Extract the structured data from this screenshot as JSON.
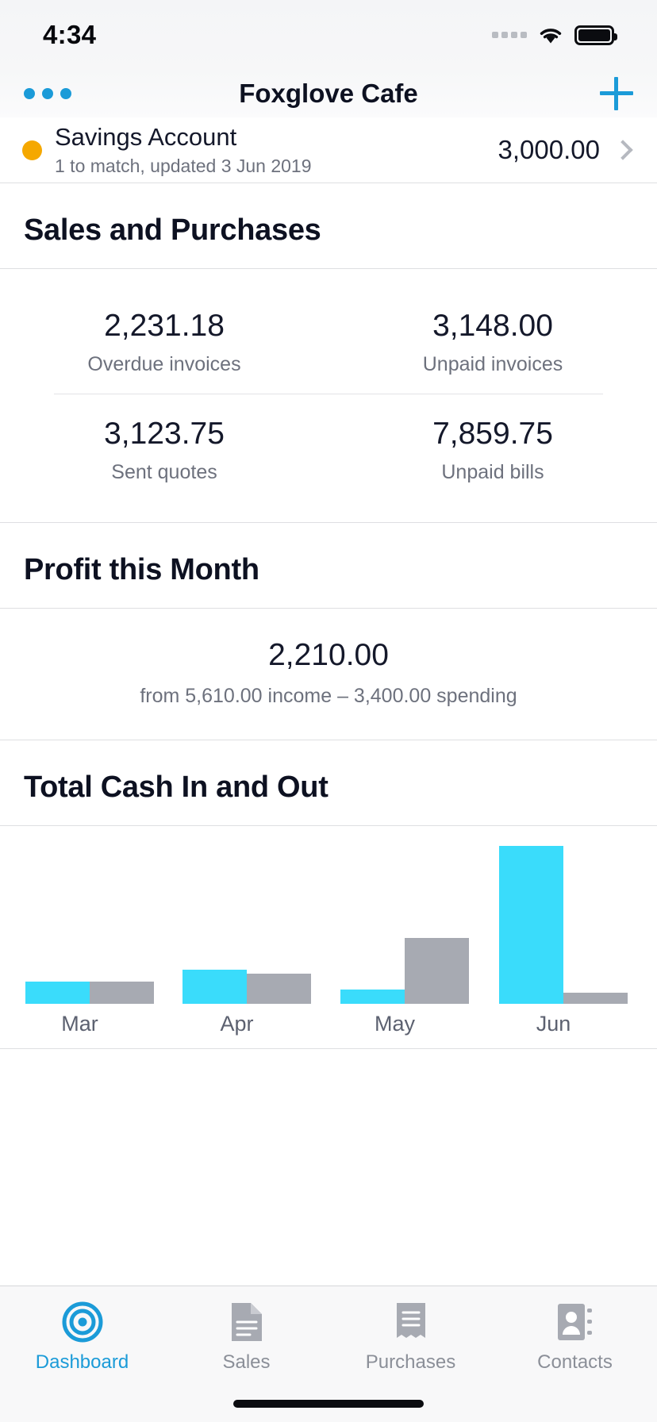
{
  "status_bar": {
    "time": "4:34",
    "cellular_icon": "signal-dots-icon",
    "wifi_icon": "wifi-icon",
    "battery_icon": "battery-full-icon"
  },
  "nav_bar": {
    "menu_icon": "more-dots-icon",
    "title": "Foxglove Cafe",
    "add_icon": "plus-icon",
    "accent_color": "#1b9bd8"
  },
  "account": {
    "status_dot_color": "#f5a800",
    "name": "Savings Account",
    "subtitle": "1 to match, updated 3 Jun 2019",
    "amount": "3,000.00",
    "chevron_icon": "chevron-right-icon"
  },
  "sales_and_purchases": {
    "heading": "Sales and Purchases",
    "metrics": [
      {
        "value": "2,231.18",
        "label": "Overdue invoices"
      },
      {
        "value": "3,148.00",
        "label": "Unpaid invoices"
      },
      {
        "value": "3,123.75",
        "label": "Sent quotes"
      },
      {
        "value": "7,859.75",
        "label": "Unpaid bills"
      }
    ]
  },
  "profit": {
    "heading": "Profit this Month",
    "value": "2,210.00",
    "subtitle": "from 5,610.00 income – 3,400.00 spending"
  },
  "cash": {
    "heading": "Total Cash In and Out"
  },
  "chart_data": {
    "type": "bar",
    "title": "Total Cash In and Out",
    "categories": [
      "Mar",
      "Apr",
      "May",
      "Jun"
    ],
    "series": [
      {
        "name": "Cash in",
        "color": "#3adcfb",
        "values": [
          28,
          43,
          18,
          199
        ]
      },
      {
        "name": "Cash out",
        "color": "#a7aab2",
        "values": [
          28,
          38,
          83,
          14
        ]
      }
    ],
    "xlabel": "",
    "ylabel": "",
    "ylim": [
      0,
      210
    ],
    "grid": false,
    "legend": "none",
    "axis_ticks": []
  },
  "tab_bar": {
    "items": [
      {
        "label": "Dashboard",
        "icon": "dashboard-target-icon",
        "active": true
      },
      {
        "label": "Sales",
        "icon": "document-icon",
        "active": false
      },
      {
        "label": "Purchases",
        "icon": "receipt-icon",
        "active": false
      },
      {
        "label": "Contacts",
        "icon": "contact-card-icon",
        "active": false
      }
    ],
    "active_color": "#1b9bd8",
    "inactive_color": "#8b8f98"
  },
  "home_indicator": "home-indicator"
}
